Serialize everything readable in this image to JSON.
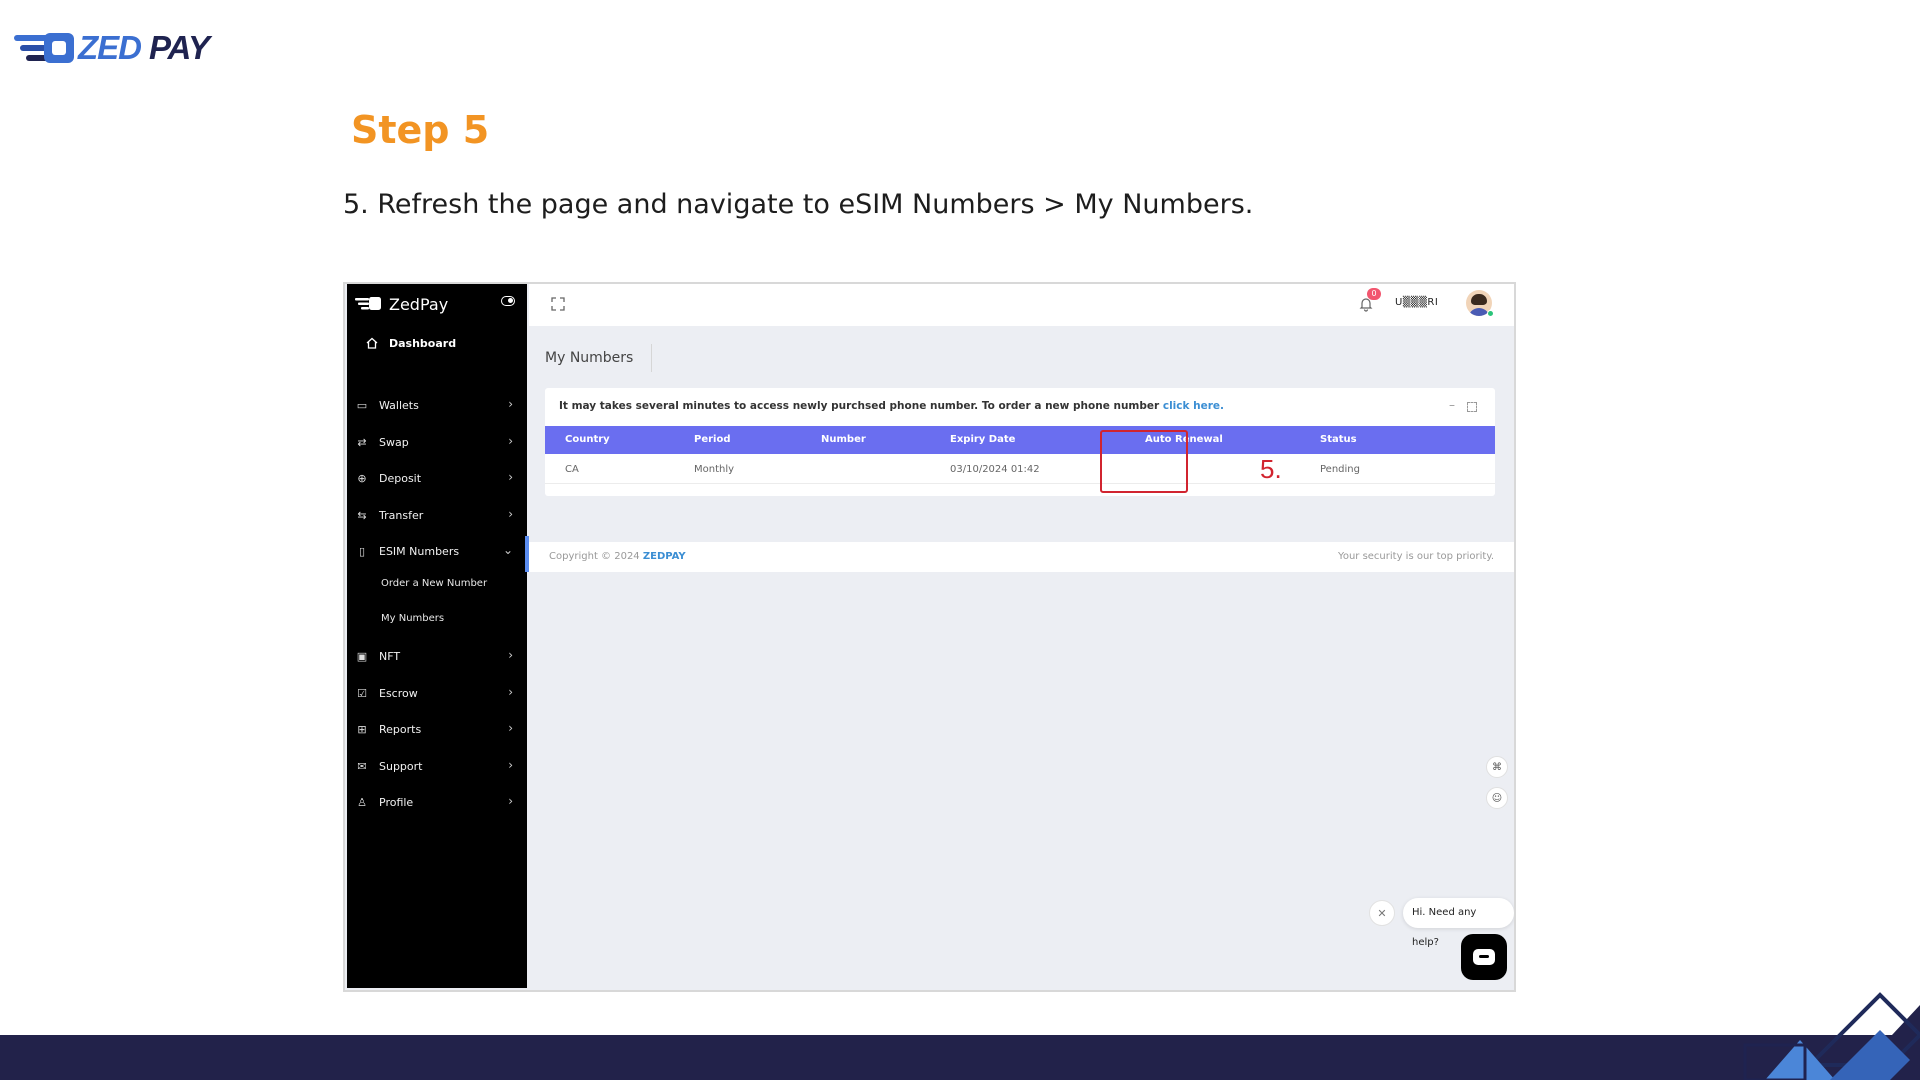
{
  "slide": {
    "logo": {
      "part1": "ZED",
      "part2": "PAY"
    },
    "step_title": "Step 5",
    "description": "5. Refresh the page and navigate to eSIM Numbers > My Numbers.",
    "colors": {
      "accent": "#f29423",
      "band": "#22224a",
      "logo_blue": "#3b6fd1"
    }
  },
  "app": {
    "brand": "ZedPay",
    "sidebar": {
      "dashboard": "Dashboard",
      "items": [
        {
          "label": "Wallets",
          "icon": "wallet-icon"
        },
        {
          "label": "Swap",
          "icon": "swap-icon"
        },
        {
          "label": "Deposit",
          "icon": "deposit-icon"
        },
        {
          "label": "Transfer",
          "icon": "transfer-icon"
        },
        {
          "label": "ESIM Numbers",
          "icon": "phone-icon"
        },
        {
          "label": "NFT",
          "icon": "image-icon"
        },
        {
          "label": "Escrow",
          "icon": "check-square-icon"
        },
        {
          "label": "Reports",
          "icon": "grid-icon"
        },
        {
          "label": "Support",
          "icon": "mail-icon"
        },
        {
          "label": "Profile",
          "icon": "user-icon"
        }
      ],
      "esim_sub": [
        "Order a New Number",
        "My Numbers"
      ]
    },
    "topbar": {
      "notification_count": "0",
      "user_name": "U▒▒▒RI"
    },
    "page_title": "My Numbers",
    "notice": {
      "text": "It may takes several minutes to access newly purchsed phone number. To order a new phone number ",
      "link": "click here."
    },
    "table": {
      "headers": [
        "Country",
        "Period",
        "Number",
        "Expiry Date",
        "Auto Renewal",
        "Status"
      ],
      "rows": [
        [
          "CA",
          "Monthly",
          "",
          "03/10/2024 01:42",
          "",
          "Pending"
        ]
      ]
    },
    "annotation": "5.",
    "footer": {
      "copyright": "Copyright © 2024 ",
      "brand": "ZEDPAY",
      "security": "Your security is our top priority."
    },
    "chat": {
      "bubble": "Hi. Need any help?"
    },
    "colors": {
      "table_header": "#6a6ef0",
      "highlight": "#d1242f",
      "link": "#3b8ed3"
    }
  }
}
